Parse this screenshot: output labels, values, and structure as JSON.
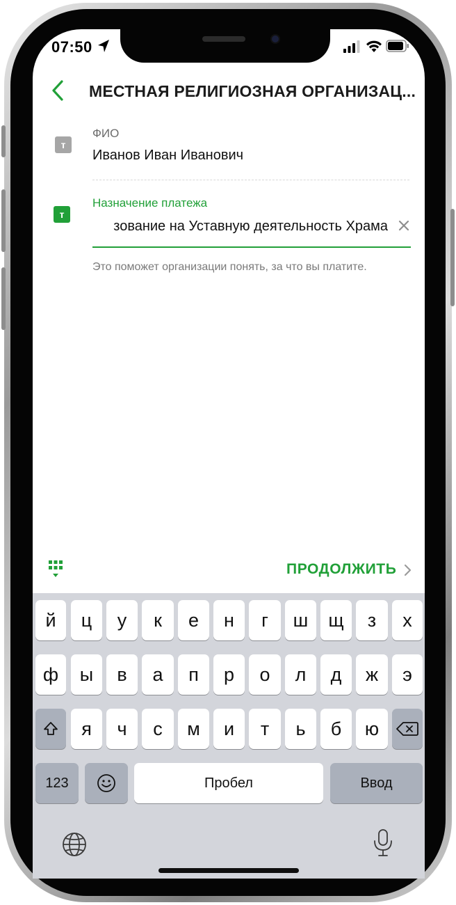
{
  "status_bar": {
    "time": "07:50"
  },
  "header": {
    "title": "МЕСТНАЯ РЕЛИГИОЗНАЯ ОРГАНИЗАЦ..."
  },
  "form": {
    "fio": {
      "icon_letter": "т",
      "label": "ФИО",
      "value": "Иванов Иван Иванович"
    },
    "purpose": {
      "icon_letter": "т",
      "label": "Назначение платежа",
      "value": "зование на Уставную деятельность Храма",
      "hint": "Это поможет организации понять, за что вы платите."
    }
  },
  "toolbar": {
    "continue_label": "ПРОДОЛЖИТЬ"
  },
  "keyboard": {
    "row1": [
      "й",
      "ц",
      "у",
      "к",
      "е",
      "н",
      "г",
      "ш",
      "щ",
      "з",
      "х"
    ],
    "row2": [
      "ф",
      "ы",
      "в",
      "а",
      "п",
      "р",
      "о",
      "л",
      "д",
      "ж",
      "э"
    ],
    "row3": [
      "я",
      "ч",
      "с",
      "м",
      "и",
      "т",
      "ь",
      "б",
      "ю"
    ],
    "numbers_label": "123",
    "space_label": "Пробел",
    "return_label": "Ввод"
  },
  "colors": {
    "accent": "#21a038",
    "keyboard_bg": "#d3d5db",
    "key_dark": "#aab0bb"
  },
  "icons": [
    "location-arrow-icon",
    "signal-icon",
    "wifi-icon",
    "battery-icon",
    "back-chevron-icon",
    "clear-icon",
    "keypad-icon",
    "chevron-right-icon",
    "shift-icon",
    "backspace-icon",
    "emoji-icon",
    "globe-icon",
    "microphone-icon"
  ]
}
